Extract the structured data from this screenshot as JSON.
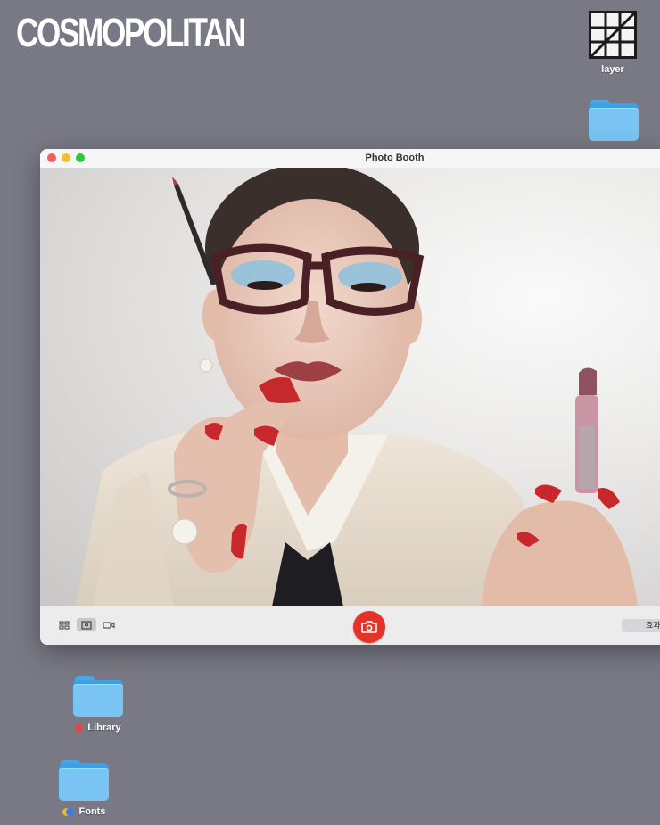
{
  "masthead": "COSMOPOLITAN",
  "desktop": {
    "icons": [
      {
        "label": "layer",
        "kind": "grid-app"
      },
      {
        "label": "",
        "kind": "folder"
      },
      {
        "label": "Library",
        "kind": "folder",
        "tag_color": "#e8453c"
      },
      {
        "label": "Fonts",
        "kind": "folder",
        "tag_colors": [
          "#f2b42a",
          "#3b7de8"
        ]
      }
    ]
  },
  "window": {
    "title": "Photo Booth",
    "traffic_lights": {
      "close": "#ee5f57",
      "minimize": "#f6bd2e",
      "zoom": "#2dc840"
    },
    "photo": {
      "subject": "photo-booth-capture"
    },
    "toolbar": {
      "modes": [
        {
          "icon": "grid-4-icon",
          "active": false
        },
        {
          "icon": "single-photo-icon",
          "active": true
        },
        {
          "icon": "video-camera-icon",
          "active": false
        }
      ],
      "shutter_icon": "camera-icon",
      "shutter_color": "#e5332a",
      "effects_label": "효과"
    }
  },
  "colors": {
    "desktop": "#797985",
    "folder": "#79c4f2"
  }
}
